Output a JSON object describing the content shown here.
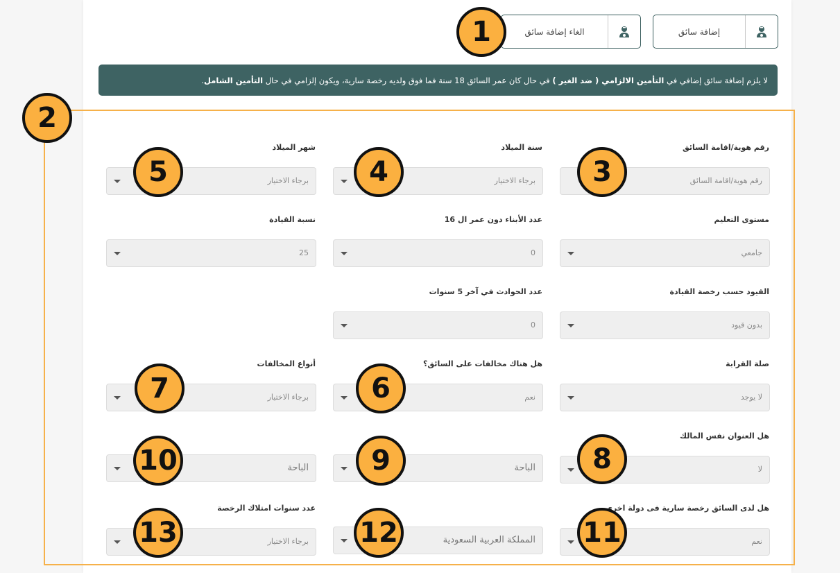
{
  "top_buttons": {
    "add_driver": "إضافة سائق",
    "cancel_add_driver": "الغاء إضافة سائق"
  },
  "notice": {
    "p1": "لا يلزم إضافة سائق إضافي في ",
    "b1": "التأمين الالزامي ( ضد الغير )",
    "p2": " في حال كان عمر السائق 18 سنة فما فوق ولديه رخصة سارية، ويكون إلزامي في حال ",
    "b2": "التأمين الشامل",
    "p3": "."
  },
  "fields": {
    "id": {
      "label": "رقم هوية/اقامة السائق",
      "placeholder": "رقم هوية/اقامة السائق"
    },
    "birth_year": {
      "label": "سنة الميلاد",
      "value": "برجاء الاختيار"
    },
    "birth_month": {
      "label": "شهر الميلاد",
      "value": "برجاء الاختيار"
    },
    "education": {
      "label": "مستوى التعليم",
      "value": "جامعي"
    },
    "children": {
      "label": "عدد الأبناء دون عمر ال 16",
      "value": "0"
    },
    "driving_ratio": {
      "label": "نسبة القيادة",
      "value": "25"
    },
    "license_restrictions": {
      "label": "القيود حسب رخصة القيادة",
      "value": "بدون قيود"
    },
    "accidents": {
      "label": "عدد الحوادث في آخر 5 سنوات",
      "value": "0"
    },
    "relation": {
      "label": "صلة القرابة",
      "value": "لا يوجد"
    },
    "violations": {
      "label": "هل هناك مخالفات على السائق؟",
      "value": "نعم"
    },
    "violation_types": {
      "label": "أنواع المخالفات",
      "value": "برجاء الاختيار"
    },
    "same_address": {
      "label": "هل العنوان نفس المالك",
      "value": "لا"
    },
    "city_2": {
      "value": "الباحة"
    },
    "city_3": {
      "value": "الباحة"
    },
    "foreign_license": {
      "label": "هل لدى السائق رخصة سارية فى دولة اخرى",
      "value": "نعم"
    },
    "license_country": {
      "value": "المملكة العربية السعودية"
    },
    "license_years": {
      "label": "عدد سنوات امتلاك الرخصة",
      "value": "برجاء الاختيار"
    }
  },
  "badges": [
    "1",
    "2",
    "3",
    "4",
    "5",
    "6",
    "7",
    "8",
    "9",
    "10",
    "11",
    "12",
    "13"
  ],
  "colors": {
    "accent": "#3e6363",
    "badge": "#fbb040",
    "highlight_box": "#f6b14a"
  }
}
